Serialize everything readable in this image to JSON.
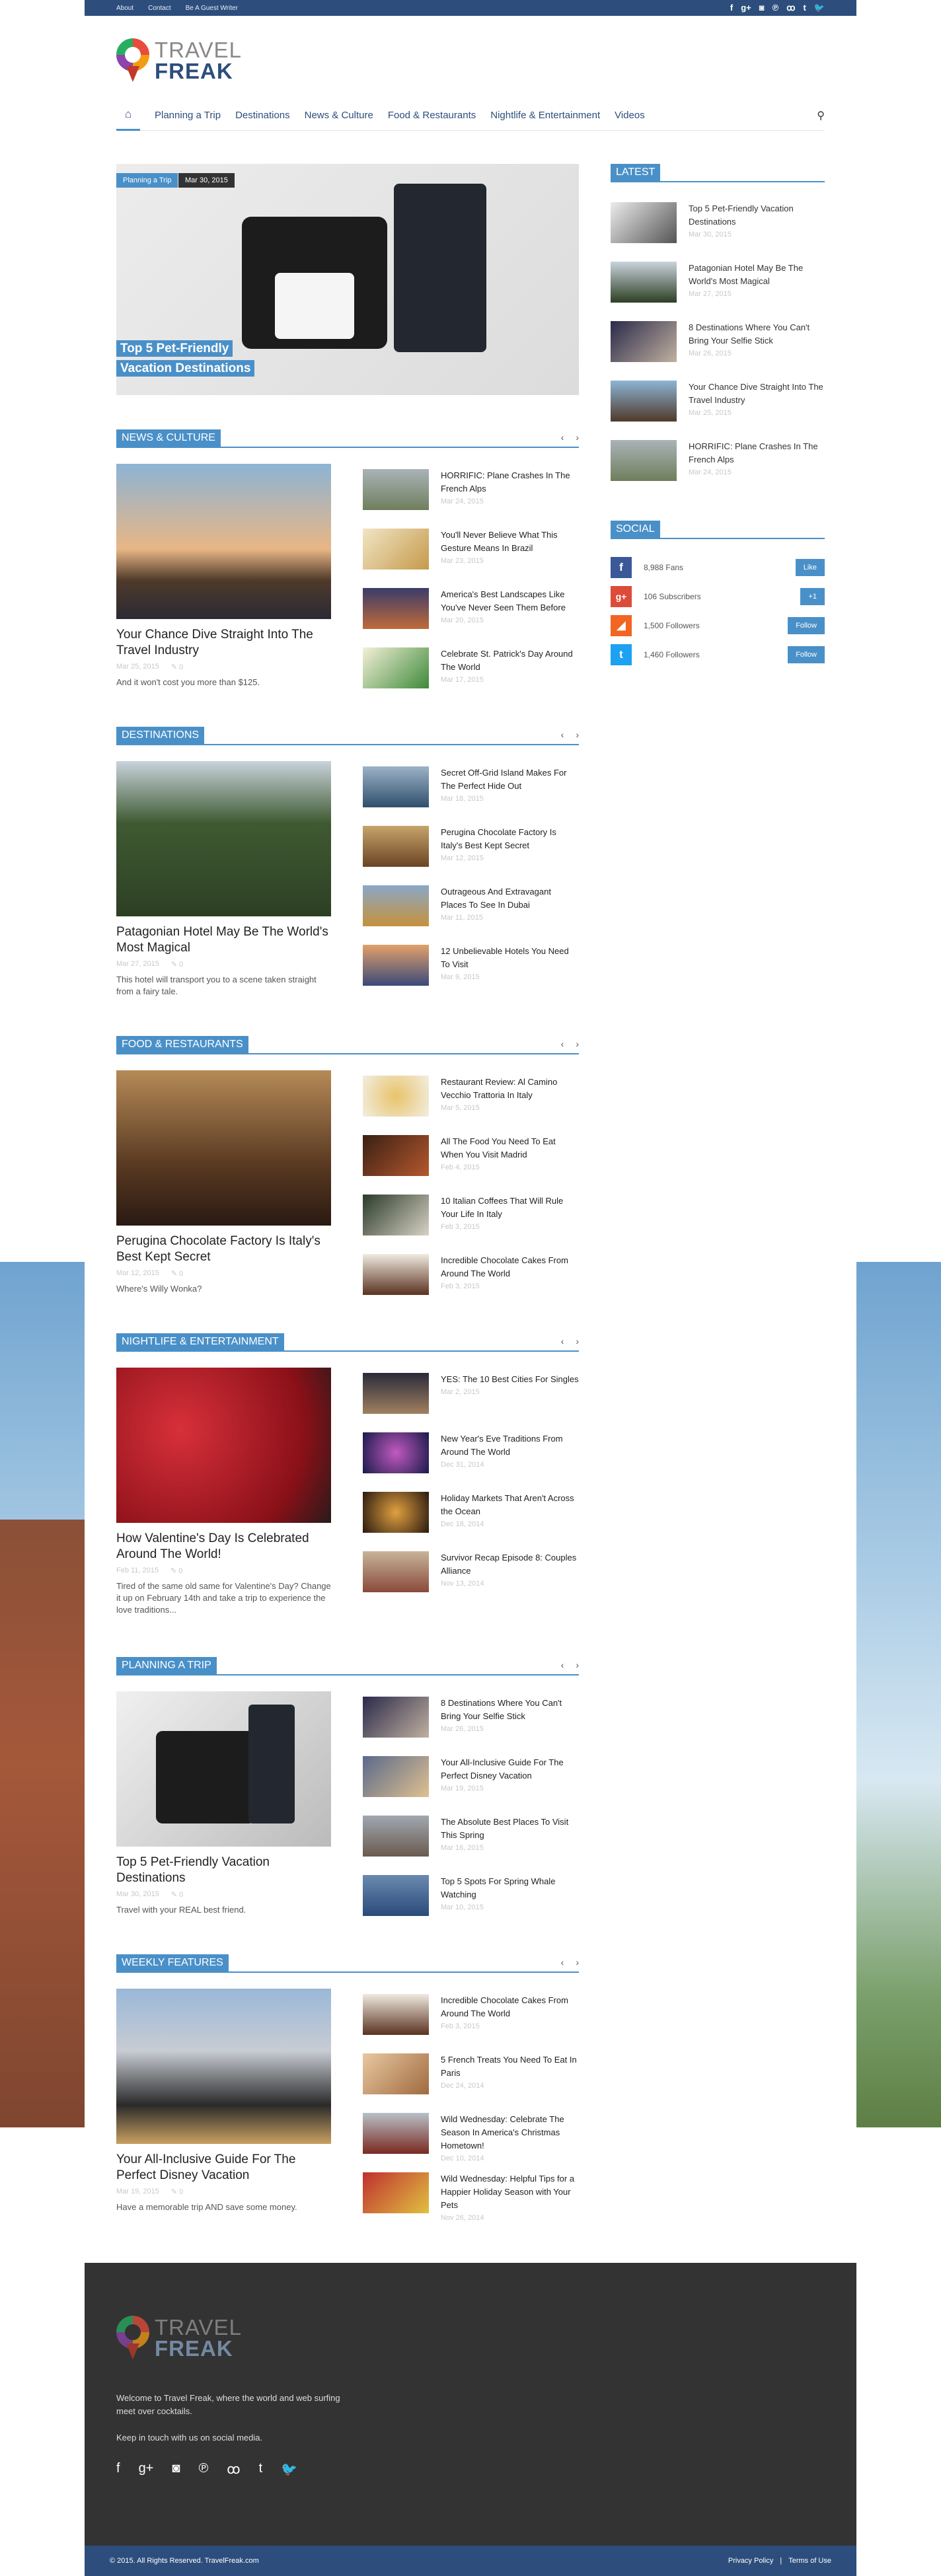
{
  "topbar": {
    "links": [
      "About",
      "Contact",
      "Be A Guest Writer"
    ],
    "social_icons": [
      "facebook-icon",
      "google-plus-icon",
      "instagram-icon",
      "pinterest-icon",
      "stumbleupon-icon",
      "tumblr-icon",
      "twitter-icon"
    ]
  },
  "logo": {
    "line1": "TRAVEL",
    "line2": "FREAK"
  },
  "nav": {
    "home_icon": "home-icon",
    "items": [
      "Planning a Trip",
      "Destinations",
      "News & Culture",
      "Food & Restaurants",
      "Nightlife & Entertainment",
      "Videos"
    ],
    "search_icon": "search-icon"
  },
  "hero": {
    "tag1": "Planning a Trip",
    "tag2": "Mar 30, 2015",
    "title": "Top 5 Pet-Friendly Vacation Destinations"
  },
  "sections": [
    {
      "label": "NEWS & CULTURE",
      "big": {
        "title": "Your Chance Dive Straight Into The Travel Industry",
        "date": "Mar 25, 2015",
        "comments": "0",
        "excerpt": "And it won't cost you more than $125."
      },
      "items": [
        {
          "title": "HORRIFIC: Plane Crashes In The French Alps",
          "date": "Mar 24, 2015"
        },
        {
          "title": "You'll Never Believe What This Gesture Means In Brazil",
          "date": "Mar 23, 2015"
        },
        {
          "title": "America's Best Landscapes Like You've Never Seen Them Before",
          "date": "Mar 20, 2015"
        },
        {
          "title": "Celebrate St. Patrick's Day Around The World",
          "date": "Mar 17, 2015"
        }
      ]
    },
    {
      "label": "DESTINATIONS",
      "big": {
        "title": "Patagonian Hotel May Be The World's Most Magical",
        "date": "Mar 27, 2015",
        "comments": "0",
        "excerpt": "This hotel will transport you to a scene taken straight from a fairy tale."
      },
      "items": [
        {
          "title": "Secret Off-Grid Island Makes For The Perfect Hide Out",
          "date": "Mar 18, 2015"
        },
        {
          "title": "Perugina Chocolate Factory Is Italy's Best Kept Secret",
          "date": "Mar 12, 2015"
        },
        {
          "title": "Outrageous And Extravagant Places To See In Dubai",
          "date": "Mar 11, 2015"
        },
        {
          "title": "12 Unbelievable Hotels You Need To Visit",
          "date": "Mar 9, 2015"
        }
      ]
    },
    {
      "label": "FOOD & RESTAURANTS",
      "big": {
        "title": "Perugina Chocolate Factory Is Italy's Best Kept Secret",
        "date": "Mar 12, 2015",
        "comments": "0",
        "excerpt": "Where's Willy Wonka?"
      },
      "items": [
        {
          "title": "Restaurant Review: Al Camino Vecchio Trattoria In Italy",
          "date": "Mar 5, 2015"
        },
        {
          "title": "All The Food You Need To Eat When You Visit Madrid",
          "date": "Feb 4, 2015"
        },
        {
          "title": "10 Italian Coffees That Will Rule Your Life In Italy",
          "date": "Feb 3, 2015"
        },
        {
          "title": "Incredible Chocolate Cakes From Around The World",
          "date": "Feb 3, 2015"
        }
      ]
    },
    {
      "label": "NIGHTLIFE & ENTERTAINMENT",
      "big": {
        "title": "How Valentine's Day Is Celebrated Around The World!",
        "date": "Feb 11, 2015",
        "comments": "0",
        "excerpt": "Tired of the same old same for Valentine's Day? Change it up on February 14th and take a trip to experience the love traditions..."
      },
      "items": [
        {
          "title": "YES: The 10 Best Cities For Singles",
          "date": "Mar 2, 2015"
        },
        {
          "title": "New Year's Eve Traditions From Around The World",
          "date": "Dec 31, 2014"
        },
        {
          "title": "Holiday Markets That Aren't Across the Ocean",
          "date": "Dec 18, 2014"
        },
        {
          "title": "Survivor Recap Episode 8: Couples Alliance",
          "date": "Nov 13, 2014"
        }
      ]
    },
    {
      "label": "PLANNING A TRIP",
      "big": {
        "title": "Top 5 Pet-Friendly Vacation Destinations",
        "date": "Mar 30, 2015",
        "comments": "0",
        "excerpt": "Travel with your REAL best friend."
      },
      "items": [
        {
          "title": "8 Destinations Where You Can't Bring Your Selfie Stick",
          "date": "Mar 26, 2015"
        },
        {
          "title": "Your All-Inclusive Guide For The Perfect Disney Vacation",
          "date": "Mar 19, 2015"
        },
        {
          "title": "The Absolute Best Places To Visit This Spring",
          "date": "Mar 16, 2015"
        },
        {
          "title": "Top 5 Spots For Spring Whale Watching",
          "date": "Mar 10, 2015"
        }
      ]
    },
    {
      "label": "WEEKLY FEATURES",
      "big": {
        "title": "Your All-Inclusive Guide For The Perfect Disney Vacation",
        "date": "Mar 19, 2015",
        "comments": "0",
        "excerpt": "Have a memorable trip AND save some money."
      },
      "items": [
        {
          "title": "Incredible Chocolate Cakes From Around The World",
          "date": "Feb 3, 2015"
        },
        {
          "title": "5 French Treats You Need To Eat In Paris",
          "date": "Dec 24, 2014"
        },
        {
          "title": "Wild Wednesday: Celebrate The Season In America's Christmas Hometown!",
          "date": "Dec 10, 2014"
        },
        {
          "title": "Wild Wednesday: Helpful Tips for a Happier Holiday Season with Your Pets",
          "date": "Nov 26, 2014"
        }
      ]
    }
  ],
  "sidebar": {
    "latest_label": "LATEST",
    "latest": [
      {
        "title": "Top 5 Pet-Friendly Vacation Destinations",
        "date": "Mar 30, 2015"
      },
      {
        "title": "Patagonian Hotel May Be The World's Most Magical",
        "date": "Mar 27, 2015"
      },
      {
        "title": "8 Destinations Where You Can't Bring Your Selfie Stick",
        "date": "Mar 26, 2015"
      },
      {
        "title": "Your Chance Dive Straight Into The Travel Industry",
        "date": "Mar 25, 2015"
      },
      {
        "title": "HORRIFIC: Plane Crashes In The French Alps",
        "date": "Mar 24, 2015"
      }
    ],
    "social_label": "SOCIAL",
    "social": [
      {
        "icon": "facebook-icon",
        "glyph": "f",
        "color": "#3b5998",
        "count": "8,988 Fans",
        "button": "Like"
      },
      {
        "icon": "google-plus-icon",
        "glyph": "g+",
        "color": "#dd4b39",
        "count": "106 Subscribers",
        "button": "+1"
      },
      {
        "icon": "rss-icon",
        "glyph": "◢",
        "color": "#f26522",
        "count": "1,500 Followers",
        "button": "Follow"
      },
      {
        "icon": "twitter-icon",
        "glyph": "t",
        "color": "#1da1f2",
        "count": "1,460 Followers",
        "button": "Follow"
      }
    ]
  },
  "footer": {
    "logo_line1": "TRAVEL",
    "logo_line2": "FREAK",
    "about": "Welcome to Travel Freak, where the world and web surfing meet over cocktails.",
    "keep": "Keep in touch with us on social media.",
    "copyright": "© 2015. All Rights Reserved. TravelFreak.com",
    "privacy": "Privacy Policy",
    "terms": "Terms of Use"
  }
}
